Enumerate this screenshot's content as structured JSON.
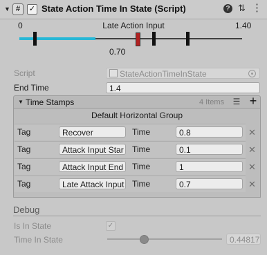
{
  "header": {
    "title": "State Action Time In State (Script)",
    "hash_glyph": "#",
    "check_glyph": "✓",
    "help_glyph": "?",
    "preset_glyph": "⇅",
    "menu_glyph": "⋮"
  },
  "timeline": {
    "min_label": "0",
    "max_label": "1.40",
    "center_label": "Late Action Input",
    "value_label": "0.70",
    "fill_color": "#27b7d6",
    "marker_color_selected": "#b22222"
  },
  "fields": {
    "script_label": "Script",
    "script_value": "StateActionTimeInState",
    "end_time_label": "End Time",
    "end_time_value": "1.4"
  },
  "time_stamps": {
    "title": "Time Stamps",
    "count": "4 Items",
    "list_glyph": "☰",
    "add_glyph": "+",
    "group_label": "Default Horizontal Group",
    "rows": [
      {
        "tag_label": "Tag",
        "tag_value": "Recover",
        "time_label": "Time",
        "time_value": "0.8",
        "remove": "✕"
      },
      {
        "tag_label": "Tag",
        "tag_value": "Attack Input Star",
        "time_label": "Time",
        "time_value": "0.1",
        "remove": "✕"
      },
      {
        "tag_label": "Tag",
        "tag_value": "Attack Input End",
        "time_label": "Time",
        "time_value": "1",
        "remove": "✕"
      },
      {
        "tag_label": "Tag",
        "tag_value": "Late Attack Input",
        "time_label": "Time",
        "time_value": "0.7",
        "remove": "✕"
      }
    ]
  },
  "debug": {
    "title": "Debug",
    "is_in_state_label": "Is In State",
    "is_in_state_glyph": "✓",
    "time_in_state_label": "Time In State",
    "time_in_state_value": "0.44817",
    "time_in_state_fraction": 0.32
  }
}
